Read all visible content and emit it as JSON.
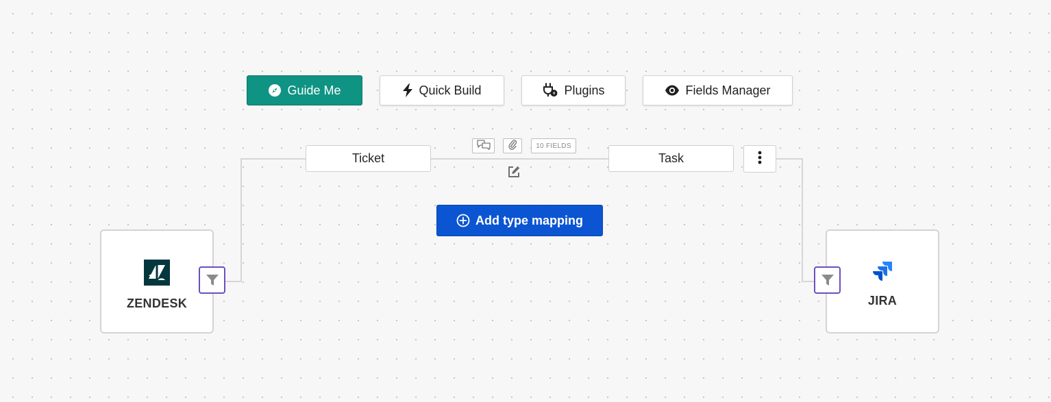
{
  "toolbar": {
    "guide_me": "Guide Me",
    "quick_build": "Quick Build",
    "plugins": "Plugins",
    "fields_manager": "Fields Manager"
  },
  "mapping": {
    "left_type": "Ticket",
    "right_type": "Task",
    "fields_badge": "10 FIELDS",
    "add_type_mapping": "Add type mapping"
  },
  "left_platform": {
    "name": "ZENDESK",
    "icon": "zendesk-logo"
  },
  "right_platform": {
    "name": "JIRA",
    "icon": "jira-logo"
  },
  "colors": {
    "guide_me_bg": "#0f9383",
    "add_mapping_bg": "#0b55d3",
    "filter_border": "#6b4fbb",
    "zendesk_brand": "#03363d",
    "jira_brand": "#2684ff"
  }
}
